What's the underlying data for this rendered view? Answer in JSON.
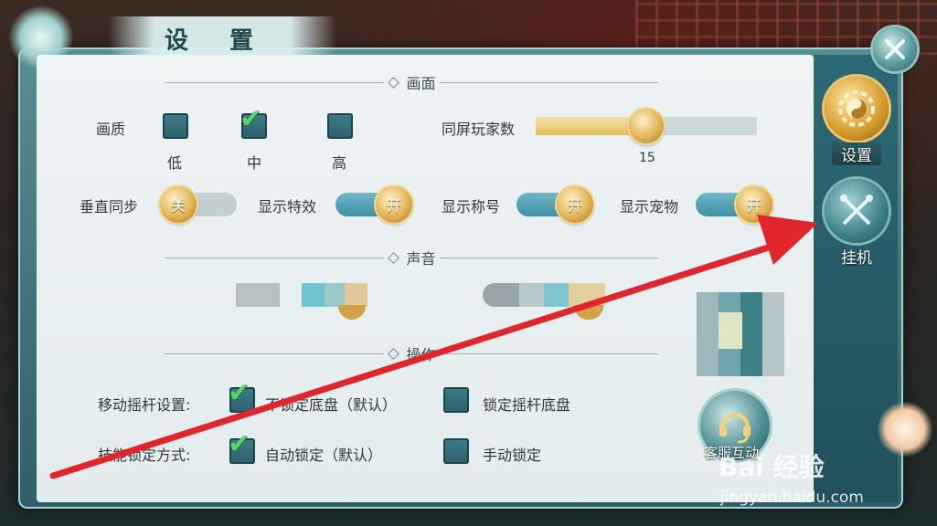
{
  "window": {
    "title": "设 置"
  },
  "sections": {
    "graphics": "画面",
    "sound": "声音",
    "controls": "操作"
  },
  "graphics": {
    "quality_label": "画质",
    "options": [
      {
        "label": "低",
        "checked": false
      },
      {
        "label": "中",
        "checked": true
      },
      {
        "label": "高",
        "checked": false
      }
    ],
    "players_label": "同屏玩家数",
    "players_value": "15",
    "players_fraction": 0.5,
    "toggles": [
      {
        "label": "垂直同步",
        "state": "关",
        "on": false
      },
      {
        "label": "显示特效",
        "state": "开",
        "on": true
      },
      {
        "label": "显示称号",
        "state": "开",
        "on": true
      },
      {
        "label": "显示宠物",
        "state": "开",
        "on": true
      }
    ]
  },
  "controls": {
    "joystick_label": "移动摇杆设置:",
    "joystick_options": [
      {
        "label": "不锁定底盘（默认）",
        "checked": true
      },
      {
        "label": "锁定摇杆底盘",
        "checked": false
      }
    ],
    "skill_label": "技能锁定方式:",
    "skill_options": [
      {
        "label": "自动锁定（默认）",
        "checked": true
      },
      {
        "label": "手动锁定",
        "checked": false
      }
    ]
  },
  "sidebar": {
    "items": [
      {
        "label": "设置",
        "icon": "yin-yang-gear-icon",
        "active": true
      },
      {
        "label": "挂机",
        "icon": "crossed-swords-icon",
        "active": false
      }
    ]
  },
  "customer_service": {
    "label": "客服互动"
  },
  "watermark": {
    "line1": "Bai 经验",
    "line2": "jingyan.baidu.com"
  },
  "colors": {
    "accent_gold": "#e2b457",
    "check_green": "#58d36a",
    "toggle_on": "#3f90a5",
    "arrow_red": "#e0262b"
  }
}
